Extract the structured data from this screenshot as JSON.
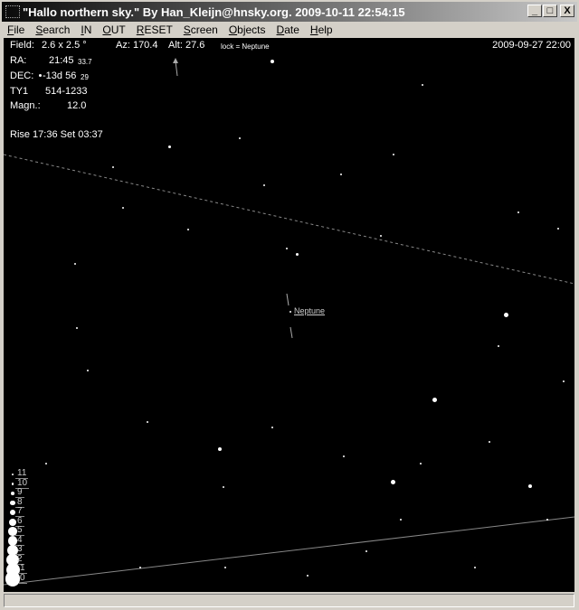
{
  "window": {
    "title": "\"Hallo northern sky.\"  By Han_Kleijn@hnsky.org.  2009-10-11  22:54:15",
    "minimize": "_",
    "maximize": "□",
    "close": "X"
  },
  "menu": [
    "File",
    "Search",
    "IN",
    "OUT",
    "RESET",
    "Screen",
    "Objects",
    "Date",
    "Help"
  ],
  "header": {
    "field_label": "Field:",
    "field_value": "2.6  x  2.5 °",
    "az": "Az: 170.4",
    "alt": "Alt:  27.6",
    "lock": "lock = Neptune",
    "datetime": "2009-09-27  22:00"
  },
  "info": {
    "ra_label": "RA:",
    "ra_value": "21:45",
    "ra_sec": "33.7",
    "dec_label": "DEC:",
    "dec_value": "-13d 56",
    "dec_sec": "29",
    "id_label": "TY1",
    "id_value": "514-1233",
    "mag_label": "Magn.:",
    "mag_value": "12.0",
    "rise_set": "Rise 17:36  Set 03:37"
  },
  "object_label": "Neptune",
  "legend": [
    "11",
    "10",
    "9",
    "8",
    "7",
    "6",
    "5",
    "4",
    "3",
    "2",
    "1",
    "0"
  ],
  "status": ""
}
